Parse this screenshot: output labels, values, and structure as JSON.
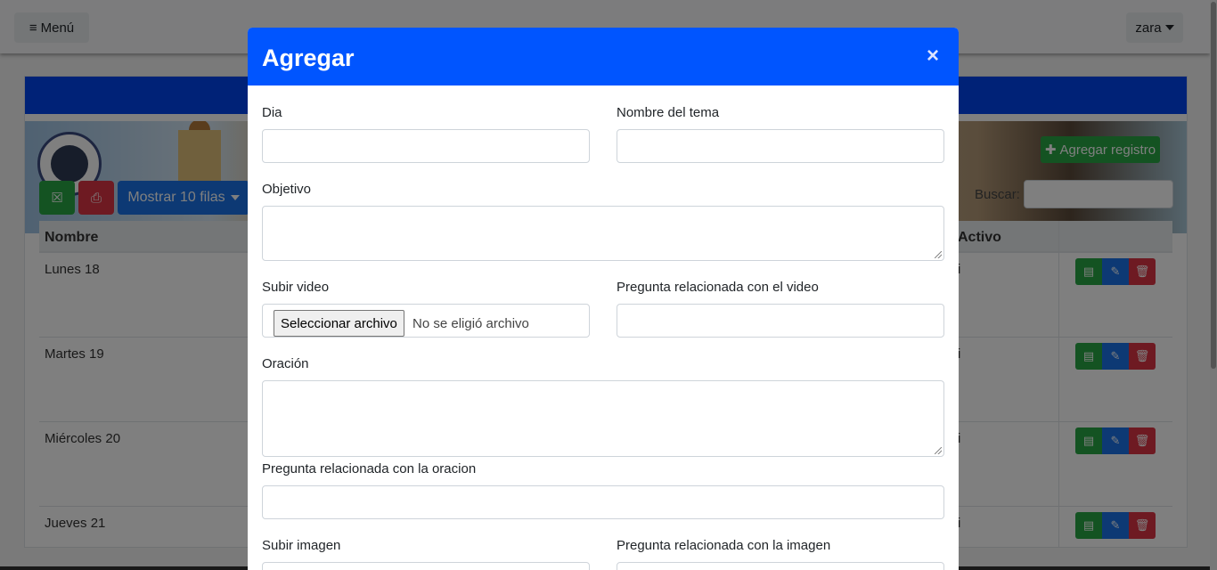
{
  "navbar": {
    "menu_label": "Menú",
    "user_label": "zara"
  },
  "toolbar": {
    "show_rows_label": "Mostrar 10 filas",
    "add_record_label": "Agregar registro",
    "search_label": "Buscar:"
  },
  "table": {
    "columns": [
      "Nombre",
      "Activo"
    ],
    "rows": [
      {
        "name": "Lunes 18",
        "active": "i"
      },
      {
        "name": "Martes 19",
        "active": "i"
      },
      {
        "name": "Miércoles 20",
        "active": "i"
      },
      {
        "name": "Jueves 21",
        "active": "i"
      }
    ]
  },
  "modal": {
    "title": "Agregar",
    "close_label": "×",
    "fields": {
      "dia": "Dia",
      "nombre_tema": "Nombre del tema",
      "objetivo": "Objetivo",
      "subir_video": "Subir video",
      "pregunta_video": "Pregunta relacionada con el video",
      "oracion": "Oración",
      "pregunta_oracion": "Pregunta relacionada con la oracion",
      "subir_imagen": "Subir imagen",
      "pregunta_imagen": "Pregunta relacionada con la imagen"
    },
    "file_input": {
      "button_label": "Seleccionar archivo",
      "status": "No se eligió archivo"
    }
  },
  "colors": {
    "primary": "#0055ff",
    "success": "#28a745",
    "danger": "#dc3545",
    "info": "#1a73e8"
  }
}
